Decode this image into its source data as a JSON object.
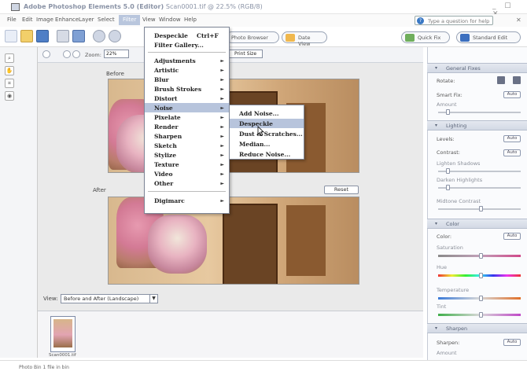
{
  "window": {
    "title": "Adobe Photoshop Elements 5.0 (Editor)",
    "title_suffix": "Scan0001.tif @ 22.5% (RGB/8)"
  },
  "menubar": {
    "items": [
      "File",
      "Edit",
      "Image",
      "Enhance",
      "Layer",
      "Select",
      "Filter",
      "View",
      "Window",
      "Help"
    ],
    "active": "Filter",
    "help_placeholder": "Type a question for help"
  },
  "shortcuts": {
    "browse_label": "Photo Browser",
    "date_view_label": "Date View",
    "quick_fix_label": "Quick Fix",
    "standard_edit_label": "Standard Edit"
  },
  "options": {
    "zoom_label": "Zoom:",
    "zoom_value": "22%",
    "print_size_label": "Print Size"
  },
  "workspace": {
    "before_label": "Before",
    "after_label": "After",
    "reset_label": "Reset",
    "view_label": "View:",
    "view_value": "Before and After (Landscape)"
  },
  "photo_bin": {
    "caption": "Scan0001.tif"
  },
  "status": {
    "text": "Photo Bin  1 file in bin"
  },
  "filter_menu": {
    "last_filter": "Despeckle",
    "last_filter_shortcut": "Ctrl+F",
    "filter_gallery": "Filter Gallery...",
    "items": [
      "Adjustments",
      "Artistic",
      "Blur",
      "Brush Strokes",
      "Distort",
      "Noise",
      "Pixelate",
      "Render",
      "Sharpen",
      "Sketch",
      "Stylize",
      "Texture",
      "Video",
      "Other"
    ],
    "highlighted": "Noise",
    "digimarc": "Digimarc"
  },
  "noise_menu": {
    "items": [
      "Add Noise...",
      "Despeckle",
      "Dust & Scratches...",
      "Median...",
      "Reduce Noise..."
    ],
    "highlighted": "Despeckle"
  },
  "palette": {
    "general_fixes": {
      "title": "General Fixes",
      "rotate_label": "Rotate:",
      "smart_fix_label": "Smart Fix:",
      "amount_label": "Amount",
      "auto": "Auto"
    },
    "lighting": {
      "title": "Lighting",
      "levels_label": "Levels:",
      "contrast_label": "Contrast:",
      "lighten_shadows": "Lighten Shadows",
      "darken_highlights": "Darken Highlights",
      "midtone_contrast": "Midtone Contrast",
      "auto": "Auto"
    },
    "color": {
      "title": "Color",
      "color_label": "Color:",
      "saturation": "Saturation",
      "hue": "Hue",
      "temperature": "Temperature",
      "tint": "Tint",
      "auto": "Auto"
    },
    "sharpen": {
      "title": "Sharpen",
      "sharpen_label": "Sharpen:",
      "amount_label": "Amount",
      "auto": "Auto"
    }
  },
  "colors": {
    "menu_highlight": "#b7c4dc",
    "accent": "#3a78c4"
  }
}
